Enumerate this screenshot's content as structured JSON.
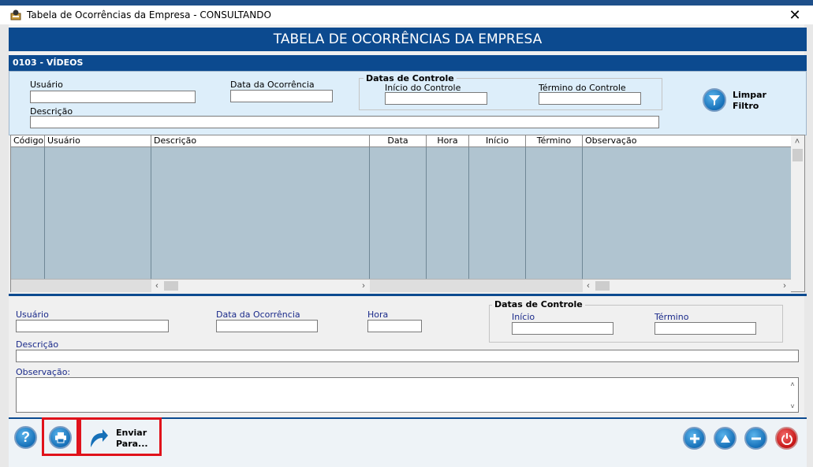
{
  "window": {
    "title": "Tabela de Ocorrências da Empresa   -   CONSULTANDO",
    "close_glyph": "✕"
  },
  "header": {
    "title": "TABELA DE OCORRÊNCIAS DA EMPRESA",
    "subtitle": "0103 - VÍDEOS"
  },
  "filter": {
    "usuario_label": "Usuário",
    "data_ocorrencia_label": "Data da Ocorrência",
    "descricao_label": "Descrição",
    "datas_controle_title": "Datas de Controle",
    "inicio_label": "Início do Controle",
    "termino_label": "Término do Controle",
    "clear_line1": "Limpar",
    "clear_line2": "Filtro"
  },
  "grid": {
    "columns": [
      "Código",
      "Usuário",
      "Descrição",
      "Data",
      "Hora",
      "Início",
      "Término",
      "Observação"
    ],
    "rows": []
  },
  "detail": {
    "usuario_label": "Usuário",
    "data_ocorrencia_label": "Data da Ocorrência",
    "hora_label": "Hora",
    "datas_controle_title": "Datas de Controle",
    "inicio_label": "Início",
    "termino_label": "Término",
    "descricao_label": "Descrição",
    "observacao_label": "Observação:"
  },
  "footer": {
    "help_glyph": "?",
    "send_line1": "Enviar",
    "send_line2": "Para..."
  },
  "colors": {
    "brand": "#0c4a8f",
    "highlight": "#e0121b"
  }
}
